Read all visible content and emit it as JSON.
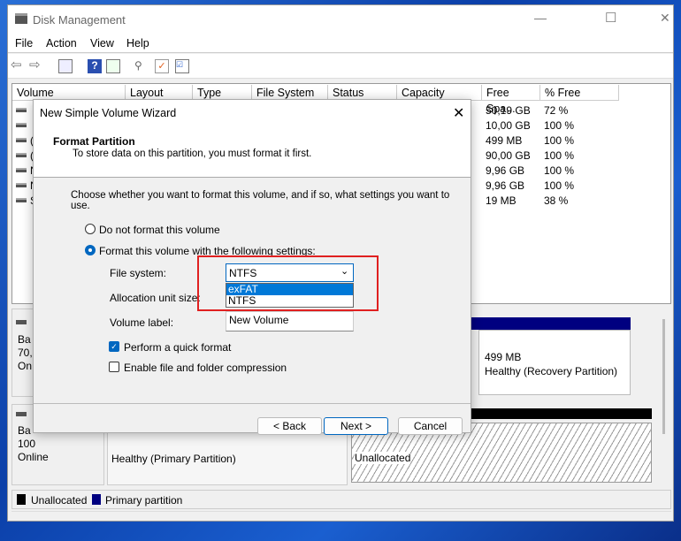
{
  "window": {
    "title": "Disk Management",
    "minimize": "—",
    "maximize": "☐",
    "close": "✕"
  },
  "menu": [
    "File",
    "Action",
    "View",
    "Help"
  ],
  "toolbar": [
    "back-icon",
    "forward-icon",
    "console-tree-icon",
    "help-icon",
    "action-pane-icon",
    "connect-icon",
    "check-icon",
    "properties-icon"
  ],
  "columns": [
    "Volume",
    "Layout",
    "Type",
    "File System",
    "Status",
    "Capacity",
    "Free Spa...",
    "% Free"
  ],
  "rows": [
    {
      "vol": "",
      "free": "50,19 GB",
      "pct": "72 %"
    },
    {
      "vol": "",
      "free": "10,00 GB",
      "pct": "100 %"
    },
    {
      "vol": "(",
      "free": "499 MB",
      "pct": "100 %"
    },
    {
      "vol": "(",
      "free": "90,00 GB",
      "pct": "100 %"
    },
    {
      "vol": "N",
      "free": "9,96 GB",
      "pct": "100 %"
    },
    {
      "vol": "N",
      "free": "9,96 GB",
      "pct": "100 %"
    },
    {
      "vol": "S",
      "free": "19 MB",
      "pct": "38 %"
    }
  ],
  "disks": [
    {
      "l1": "Ba",
      "l2": "70,",
      "l3": "On",
      "recovery_size": "499 MB",
      "recovery_status": "Healthy (Recovery Partition)"
    },
    {
      "l1": "Ba",
      "l2": "100",
      "l3": "Online",
      "primary_status": "Healthy (Primary Partition)",
      "unalloc": "Unallocated"
    }
  ],
  "legend": {
    "unallocated": "Unallocated",
    "primary": "Primary partition",
    "unallocated_color": "#000000",
    "primary_color": "#000080"
  },
  "dialog": {
    "title": "New Simple Volume Wizard",
    "heading": "Format Partition",
    "subheading": "To store data on this partition, you must format it first.",
    "instruction": "Choose whether you want to format this volume, and if so, what settings you want to use.",
    "opt_no": "Do not format this volume",
    "opt_yes": "Format this volume with the following settings:",
    "fs_label": "File system:",
    "fs_value": "NTFS",
    "fs_options": [
      "exFAT",
      "NTFS"
    ],
    "alloc_label": "Allocation unit size:",
    "vol_label": "Volume label:",
    "vol_value": "New Volume",
    "quick": "Perform a quick format",
    "quick_checked": true,
    "compress": "Enable file and folder compression",
    "compress_checked": false,
    "back": "< Back",
    "next": "Next >",
    "cancel": "Cancel",
    "highlight_color": "#e02020"
  }
}
